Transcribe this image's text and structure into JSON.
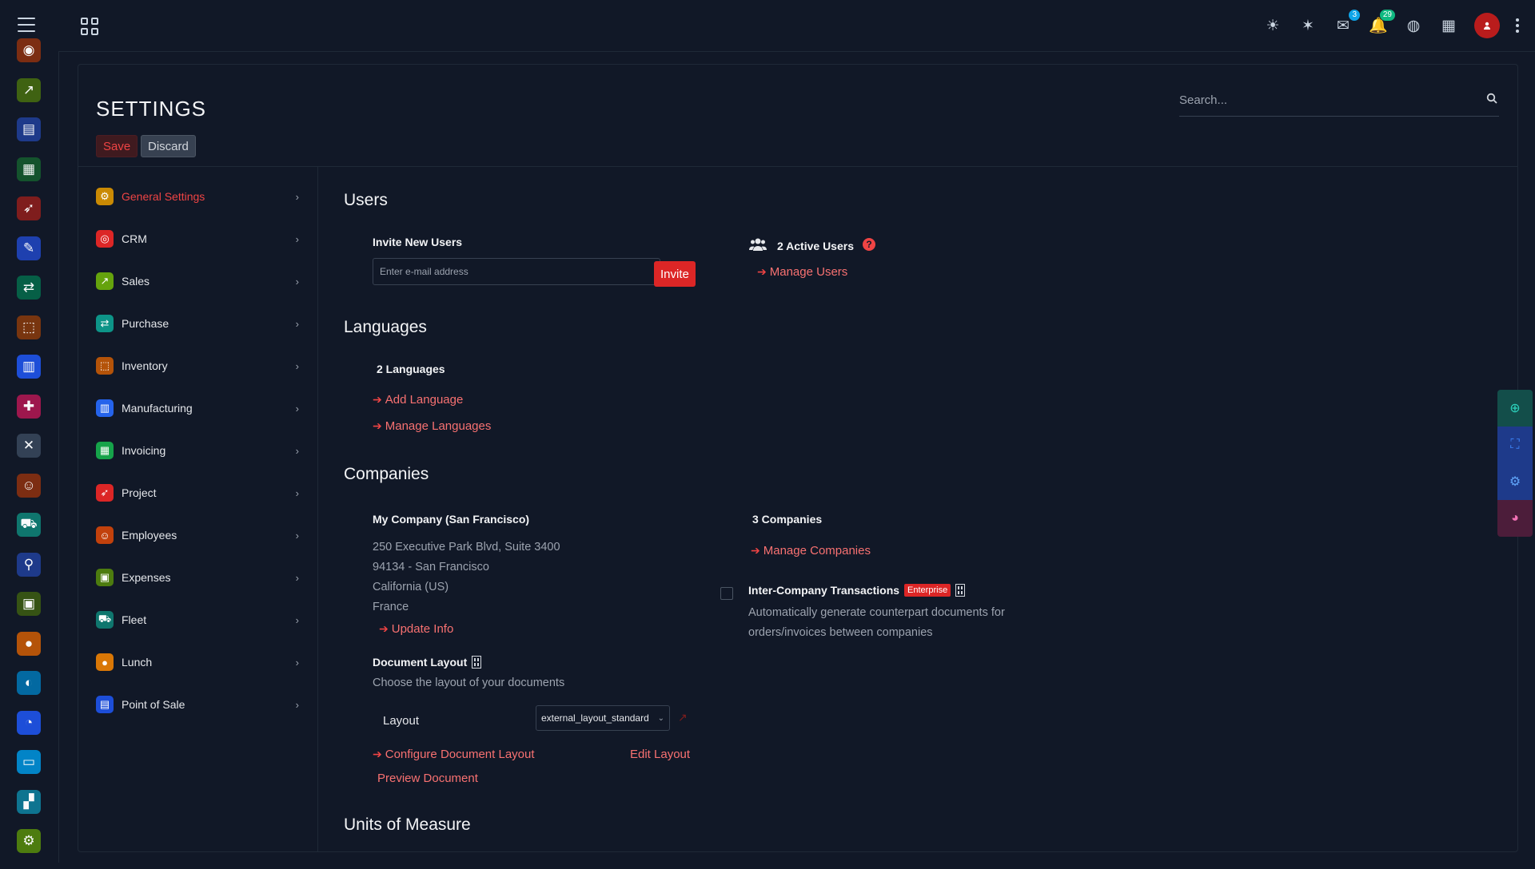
{
  "colors": {
    "accent": "#dc2626",
    "background": "#111827",
    "link": "#f87171"
  },
  "topbar": {
    "menu_icon": "hamburger-icon",
    "apps_icon": "apps-grid-icon",
    "icons": [
      {
        "name": "theme-toggle-icon",
        "glyph": "☀"
      },
      {
        "name": "debug-icon",
        "glyph": "✶"
      },
      {
        "name": "messages-icon",
        "glyph": "✉",
        "badge": "3"
      },
      {
        "name": "notifications-icon",
        "glyph": "🔔",
        "badge": "29"
      },
      {
        "name": "language-icon",
        "glyph": "◍"
      },
      {
        "name": "company-switch-icon",
        "glyph": "▦"
      }
    ]
  },
  "rail": {
    "icons": [
      {
        "name": "crm-app-icon",
        "glyph": "◉",
        "bg": "#7c2d12"
      },
      {
        "name": "sales-app-icon",
        "glyph": "↗",
        "bg": "#3f6212"
      },
      {
        "name": "point-of-sale-app-icon",
        "glyph": "▤",
        "bg": "#1e3a8a"
      },
      {
        "name": "invoicing-app-icon",
        "glyph": "▦",
        "bg": "#14532d"
      },
      {
        "name": "project-app-icon",
        "glyph": "➶",
        "bg": "#7f1d1d"
      },
      {
        "name": "documents-app-icon",
        "glyph": "✎",
        "bg": "#1e40af"
      },
      {
        "name": "purchase-app-icon",
        "glyph": "⇄",
        "bg": "#065f46"
      },
      {
        "name": "inventory-app-icon",
        "glyph": "⬚",
        "bg": "#78350f"
      },
      {
        "name": "manufacturing-app-icon",
        "glyph": "▥",
        "bg": "#1d4ed8"
      },
      {
        "name": "repair-app-icon",
        "glyph": "✚",
        "bg": "#9d174d"
      },
      {
        "name": "tools-app-icon",
        "glyph": "✕",
        "bg": "#334155"
      },
      {
        "name": "employees-app-icon",
        "glyph": "☺",
        "bg": "#7c2d12"
      },
      {
        "name": "fleet-app-icon",
        "glyph": "⛟",
        "bg": "#0f766e"
      },
      {
        "name": "attendance-app-icon",
        "glyph": "⚲",
        "bg": "#1e3a8a"
      },
      {
        "name": "expenses-app-icon",
        "glyph": "▣",
        "bg": "#365314"
      },
      {
        "name": "lunch-app-icon",
        "glyph": "●",
        "bg": "#b45309"
      },
      {
        "name": "discuss-app-icon",
        "glyph": "◐",
        "bg": "#0369a1"
      },
      {
        "name": "dashboards-app-icon",
        "glyph": "◔",
        "bg": "#1d4ed8"
      },
      {
        "name": "website-app-icon",
        "glyph": "▭",
        "bg": "#0284c7"
      },
      {
        "name": "apps-app-icon",
        "glyph": "▞",
        "bg": "#0e7490"
      },
      {
        "name": "settings-app-icon",
        "glyph": "⚙",
        "bg": "#4d7c0f"
      }
    ]
  },
  "header": {
    "title": "SETTINGS",
    "save_label": "Save",
    "discard_label": "Discard",
    "search_placeholder": "Search..."
  },
  "sidebar": {
    "items": [
      {
        "label": "General Settings",
        "icon": "general-settings-icon",
        "glyph": "⚙",
        "color": "#ca8a04",
        "active": true
      },
      {
        "label": "CRM",
        "icon": "crm-icon",
        "glyph": "◎",
        "color": "#dc2626"
      },
      {
        "label": "Sales",
        "icon": "sales-icon",
        "glyph": "↗",
        "color": "#65a30d"
      },
      {
        "label": "Purchase",
        "icon": "purchase-icon",
        "glyph": "⇄",
        "color": "#0d9488"
      },
      {
        "label": "Inventory",
        "icon": "inventory-icon",
        "glyph": "⬚",
        "color": "#b45309"
      },
      {
        "label": "Manufacturing",
        "icon": "manufacturing-icon",
        "glyph": "▥",
        "color": "#2563eb"
      },
      {
        "label": "Invoicing",
        "icon": "invoicing-icon",
        "glyph": "▦",
        "color": "#16a34a"
      },
      {
        "label": "Project",
        "icon": "project-icon",
        "glyph": "➶",
        "color": "#dc2626"
      },
      {
        "label": "Employees",
        "icon": "employees-icon",
        "glyph": "☺",
        "color": "#c2410c"
      },
      {
        "label": "Expenses",
        "icon": "expenses-icon",
        "glyph": "▣",
        "color": "#4d7c0f"
      },
      {
        "label": "Fleet",
        "icon": "fleet-icon",
        "glyph": "⛟",
        "color": "#0f766e"
      },
      {
        "label": "Lunch",
        "icon": "lunch-icon",
        "glyph": "●",
        "color": "#d97706"
      },
      {
        "label": "Point of Sale",
        "icon": "point-of-sale-icon",
        "glyph": "▤",
        "color": "#1d4ed8"
      }
    ]
  },
  "users": {
    "title": "Users",
    "invite_title": "Invite New Users",
    "email_placeholder": "Enter e-mail address",
    "invite_label": "Invite",
    "active_users": "2 Active Users",
    "manage_users": "Manage Users"
  },
  "languages": {
    "title": "Languages",
    "count": "2 Languages",
    "add_language": "Add Language",
    "manage_languages": "Manage Languages"
  },
  "companies": {
    "title": "Companies",
    "company_name": "My Company (San Francisco)",
    "address": [
      "250 Executive Park Blvd, Suite 3400",
      "94134 - San Francisco",
      "California (US)",
      "France"
    ],
    "update_info": "Update Info",
    "count": "3 Companies",
    "manage_companies": "Manage Companies",
    "inter_company_title": "Inter-Company Transactions",
    "enterprise_badge": "Enterprise",
    "inter_company_desc_1": "Automatically generate counterpart documents for",
    "inter_company_desc_2": "orders/invoices between companies",
    "doc_layout_title": "Document Layout",
    "doc_layout_desc": "Choose the layout of your documents",
    "layout_label": "Layout",
    "layout_value": "external_layout_standard",
    "configure_layout": "Configure Document Layout",
    "edit_layout": "Edit Layout",
    "preview_document": "Preview Document"
  },
  "uom": {
    "title": "Units of Measure"
  },
  "float_tools": [
    {
      "name": "zoom-in-icon",
      "glyph": "⊕",
      "bg": "#134e4a",
      "color": "#2dd4bf"
    },
    {
      "name": "fullscreen-icon",
      "glyph": "⛶",
      "bg": "#1e3a8a",
      "color": "#3b82f6"
    },
    {
      "name": "settings-gear-icon",
      "glyph": "⚙",
      "bg": "#1e3a8a",
      "color": "#60a5fa"
    },
    {
      "name": "palette-icon",
      "glyph": "◕",
      "bg": "#4c1d3a",
      "color": "#f472b6"
    }
  ]
}
